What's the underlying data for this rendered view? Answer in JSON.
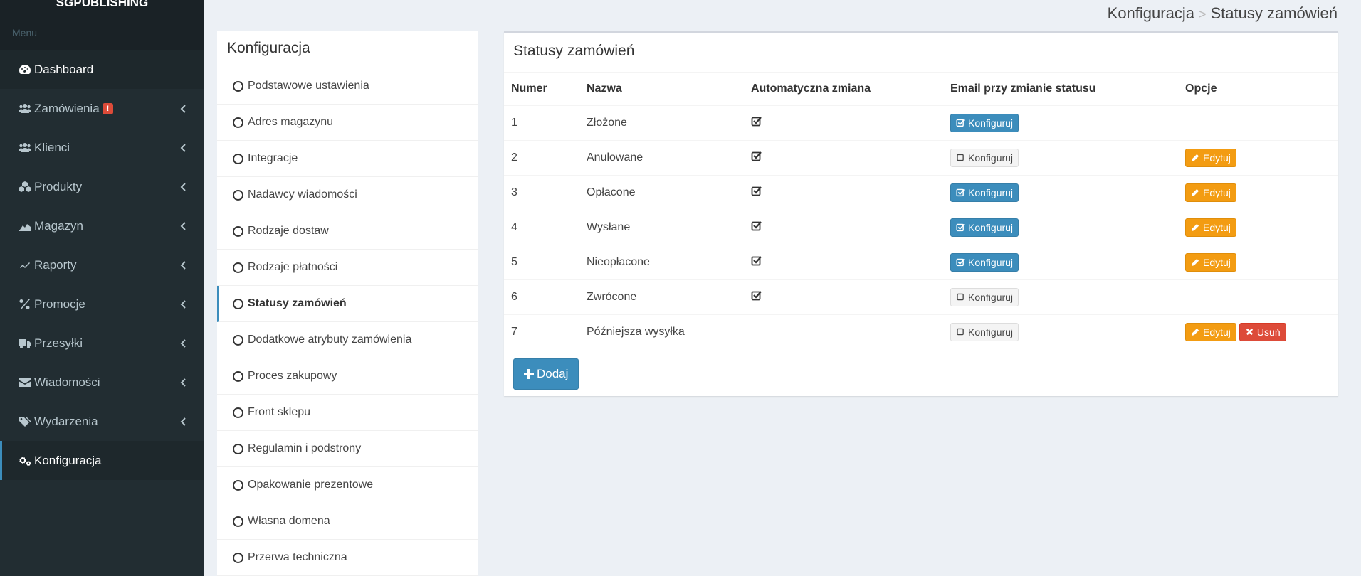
{
  "sidebar": {
    "brand": "SGPUBLISHING",
    "menu_header": "Menu",
    "items": [
      {
        "label": "Dashboard",
        "icon": "dashboard-icon"
      },
      {
        "label": "Zamówienia",
        "icon": "users-icon",
        "badge": "!"
      },
      {
        "label": "Klienci",
        "icon": "users-icon"
      },
      {
        "label": "Produkty",
        "icon": "cubes-icon"
      },
      {
        "label": "Magazyn",
        "icon": "area-chart-icon"
      },
      {
        "label": "Raporty",
        "icon": "line-chart-icon"
      },
      {
        "label": "Promocje",
        "icon": "percent-icon"
      },
      {
        "label": "Przesyłki",
        "icon": "truck-icon"
      },
      {
        "label": "Wiadomości",
        "icon": "envelope-icon"
      },
      {
        "label": "Wydarzenia",
        "icon": "tags-icon"
      },
      {
        "label": "Konfiguracja",
        "icon": "cogs-icon"
      }
    ]
  },
  "breadcrumb": {
    "parent": "Konfiguracja",
    "separator": ">",
    "current": "Statusy zamówień"
  },
  "config_panel": {
    "title": "Konfiguracja",
    "items": [
      "Podstawowe ustawienia",
      "Adres magazynu",
      "Integracje",
      "Nadawcy wiadomości",
      "Rodzaje dostaw",
      "Rodzaje płatności",
      "Statusy zamówień",
      "Dodatkowe atrybuty zamówienia",
      "Proces zakupowy",
      "Front sklepu",
      "Regulamin i podstrony",
      "Opakowanie prezentowe",
      "Własna domena",
      "Przerwa techniczna"
    ]
  },
  "statuses": {
    "title": "Statusy zamówień",
    "columns": [
      "Numer",
      "Nazwa",
      "Automatyczna zmiana",
      "Email przy zmianie statusu",
      "Opcje"
    ],
    "configure_label": "Konfiguruj",
    "edit_label": "Edytuj",
    "delete_label": "Usuń",
    "add_label": "Dodaj",
    "rows": [
      {
        "number": "1",
        "name": "Złożone",
        "auto": true,
        "email": true,
        "edit": false,
        "delete": false
      },
      {
        "number": "2",
        "name": "Anulowane",
        "auto": true,
        "email": false,
        "edit": true,
        "delete": false
      },
      {
        "number": "3",
        "name": "Opłacone",
        "auto": true,
        "email": true,
        "edit": true,
        "delete": false
      },
      {
        "number": "4",
        "name": "Wysłane",
        "auto": true,
        "email": true,
        "edit": true,
        "delete": false
      },
      {
        "number": "5",
        "name": "Nieopłacone",
        "auto": true,
        "email": true,
        "edit": true,
        "delete": false
      },
      {
        "number": "6",
        "name": "Zwrócone",
        "auto": true,
        "email": false,
        "edit": false,
        "delete": false
      },
      {
        "number": "7",
        "name": "Późniejsza wysyłka",
        "auto": false,
        "email": false,
        "edit": true,
        "delete": true
      }
    ]
  },
  "colors": {
    "sidebar": "#222d32",
    "primary": "#3c8dbc",
    "warning": "#f39c12",
    "danger": "#dd4b39"
  }
}
